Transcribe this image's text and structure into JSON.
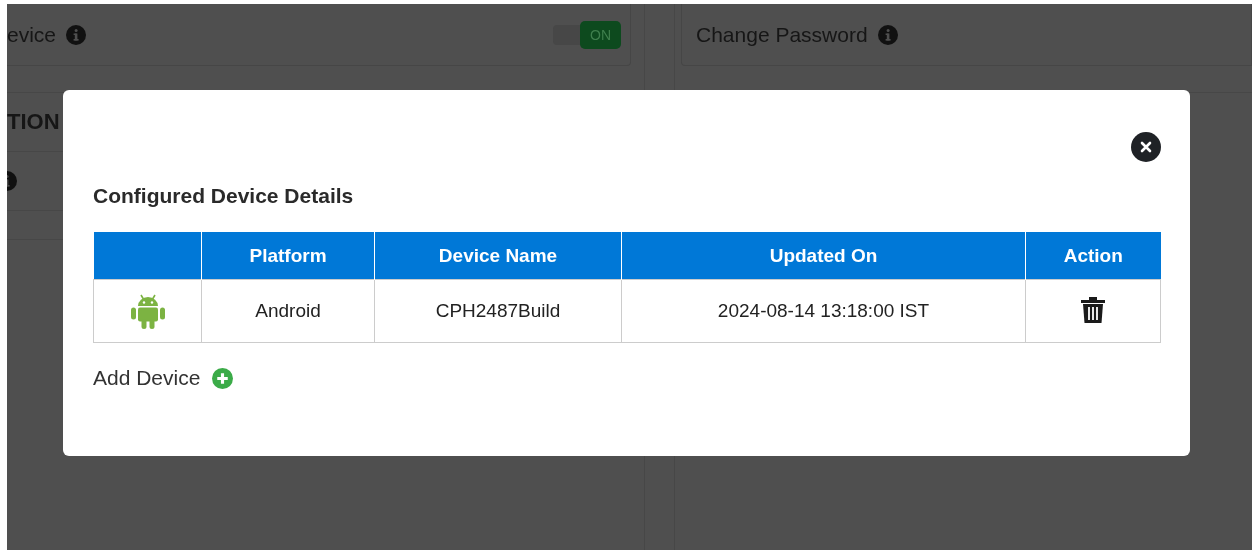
{
  "background": {
    "cards": [
      {
        "label": "evice",
        "toggle": {
          "label": "ON",
          "on": true
        }
      },
      {
        "label": "Change Password"
      }
    ],
    "section_heading": "TION"
  },
  "modal": {
    "title": "Configured Device Details",
    "table": {
      "columns": [
        "Platform",
        "Device Name",
        "Updated On",
        "Action"
      ],
      "rows": [
        {
          "platform": "Android",
          "device_name": "CPH2487Build",
          "updated_on": "2024-08-14 13:18:00 IST"
        }
      ]
    },
    "add_link": "Add Device"
  }
}
